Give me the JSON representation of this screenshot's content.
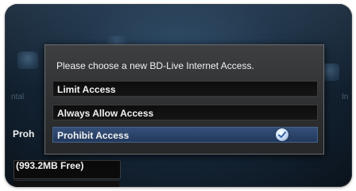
{
  "dialog": {
    "title": "Please choose a new BD-Live Internet Access.",
    "options": [
      {
        "label": "Limit Access",
        "selected": false
      },
      {
        "label": "Always Allow Access",
        "selected": false
      },
      {
        "label": "Prohibit Access",
        "selected": true
      }
    ]
  },
  "background": {
    "current_setting_partial": "Proh",
    "storage_free": "(993.2MB Free)",
    "left_menu_partial": "ntal",
    "right_menu_partial": "In"
  },
  "colors": {
    "dialog_bg": "#333436",
    "selected_option": "#2d4670",
    "option_bg": "#111111",
    "text": "#f2f2f2",
    "screen_bg": "#16283a"
  },
  "icons": {
    "selected_check": "check-circle-icon"
  }
}
